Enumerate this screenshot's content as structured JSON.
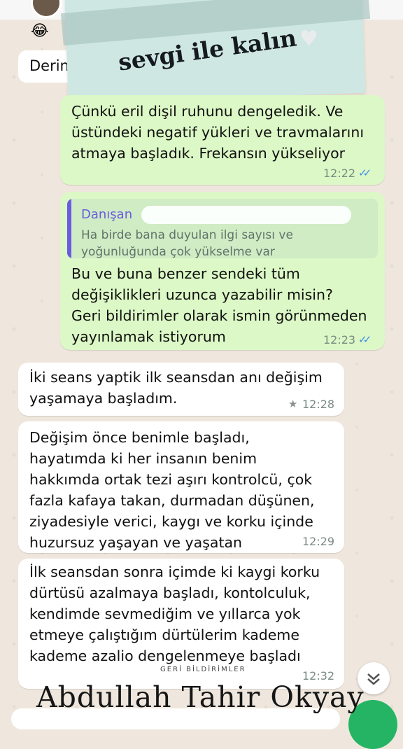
{
  "banner": {
    "text": "sevgi ile kalın"
  },
  "chat": {
    "partial_bubble": "Derin",
    "messages": [
      {
        "text": "Çünkü eril dişil ruhunu dengeledik. Ve\nüstündeki negatif yükleri ve travmalarını\natmaya başladık. Frekansın yükseliyor",
        "time": "12:22"
      },
      {
        "quote_name": "Danışan",
        "quote_text": "Ha birde bana duyulan ilgi sayısı ve\nyoğunluğunda çok yükselme var",
        "text": "Bu ve buna benzer sendeki tüm\ndeğişiklikleri uzunca yazabilir misin?\nGeri bildirimler olarak ismin görünmeden\nyayınlamak istiyorum",
        "time": "12:23"
      },
      {
        "text": "İki seans yaptik ilk seansdan anı değişim\nyaşamaya başladım.",
        "time": "12:28"
      },
      {
        "text": "Değişim önce benimle başladı,\nhayatımda ki her insanın benim\nhakkımda ortak tezi aşırı kontrolcü, çok\nfazla kafaya takan, durmadan düşünen,\nziyadesiyle verici, kaygı ve korku içinde\nhuzursuz yaşayan ve yaşatan",
        "time": "12:29"
      },
      {
        "text": "İlk seansdan sonra içimde ki kaygi korku\ndürtüsü azalmaya başladı, kontolculuk,\nkendimde sevmediğim ve yıllarca yok\netmeye çalıştığım dürtülerim kademe\nkademe azalio dengelenmeye başladı",
        "time": "12:32"
      }
    ]
  },
  "overlay": {
    "caption": "GERİ BİLDİRİMLER",
    "signature": "Abdullah Tahir Okyay"
  },
  "icons": {
    "ticks": "✓✓",
    "star": "★",
    "chevron": "⌄⌄",
    "heart": "♥",
    "emoji": "😂"
  }
}
